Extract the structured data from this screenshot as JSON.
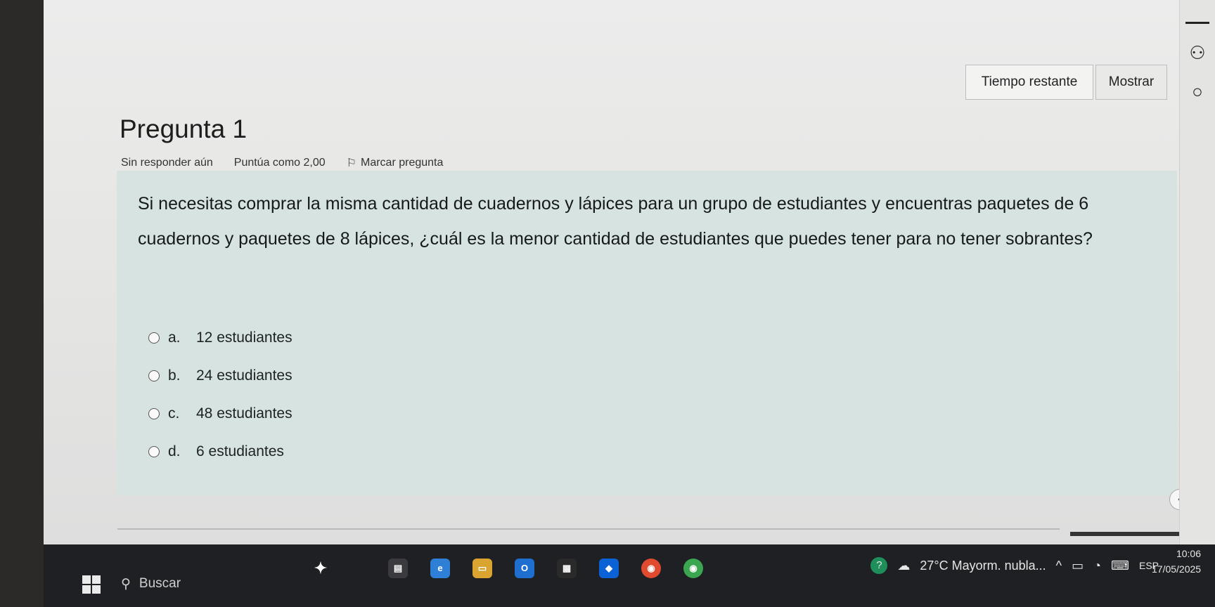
{
  "header": {
    "timer_label": "Tiempo restante",
    "show_button": "Mostrar"
  },
  "question": {
    "title": "Pregunta 1",
    "status": "Sin responder aún",
    "score": "Puntúa como 2,00",
    "flag_label": "Marcar pregunta",
    "text": "Si necesitas comprar la misma cantidad de cuadernos y lápices para un grupo de estudiantes y encuentras paquetes de 6 cuadernos y paquetes de 8 lápices, ¿cuál es la menor cantidad de estudiantes que puedes tener para no tener sobrantes?",
    "options": [
      {
        "letter": "a.",
        "label": "12 estudiantes"
      },
      {
        "letter": "b.",
        "label": "24 estudiantes"
      },
      {
        "letter": "c.",
        "label": "48 estudiantes"
      },
      {
        "letter": "d.",
        "label": "6 estudiantes"
      }
    ]
  },
  "taskbar": {
    "search_placeholder": "Buscar",
    "weather": "27°C  Mayorm. nubla...",
    "language": "ESP",
    "time": "10:06",
    "date": "17/05/2025"
  }
}
